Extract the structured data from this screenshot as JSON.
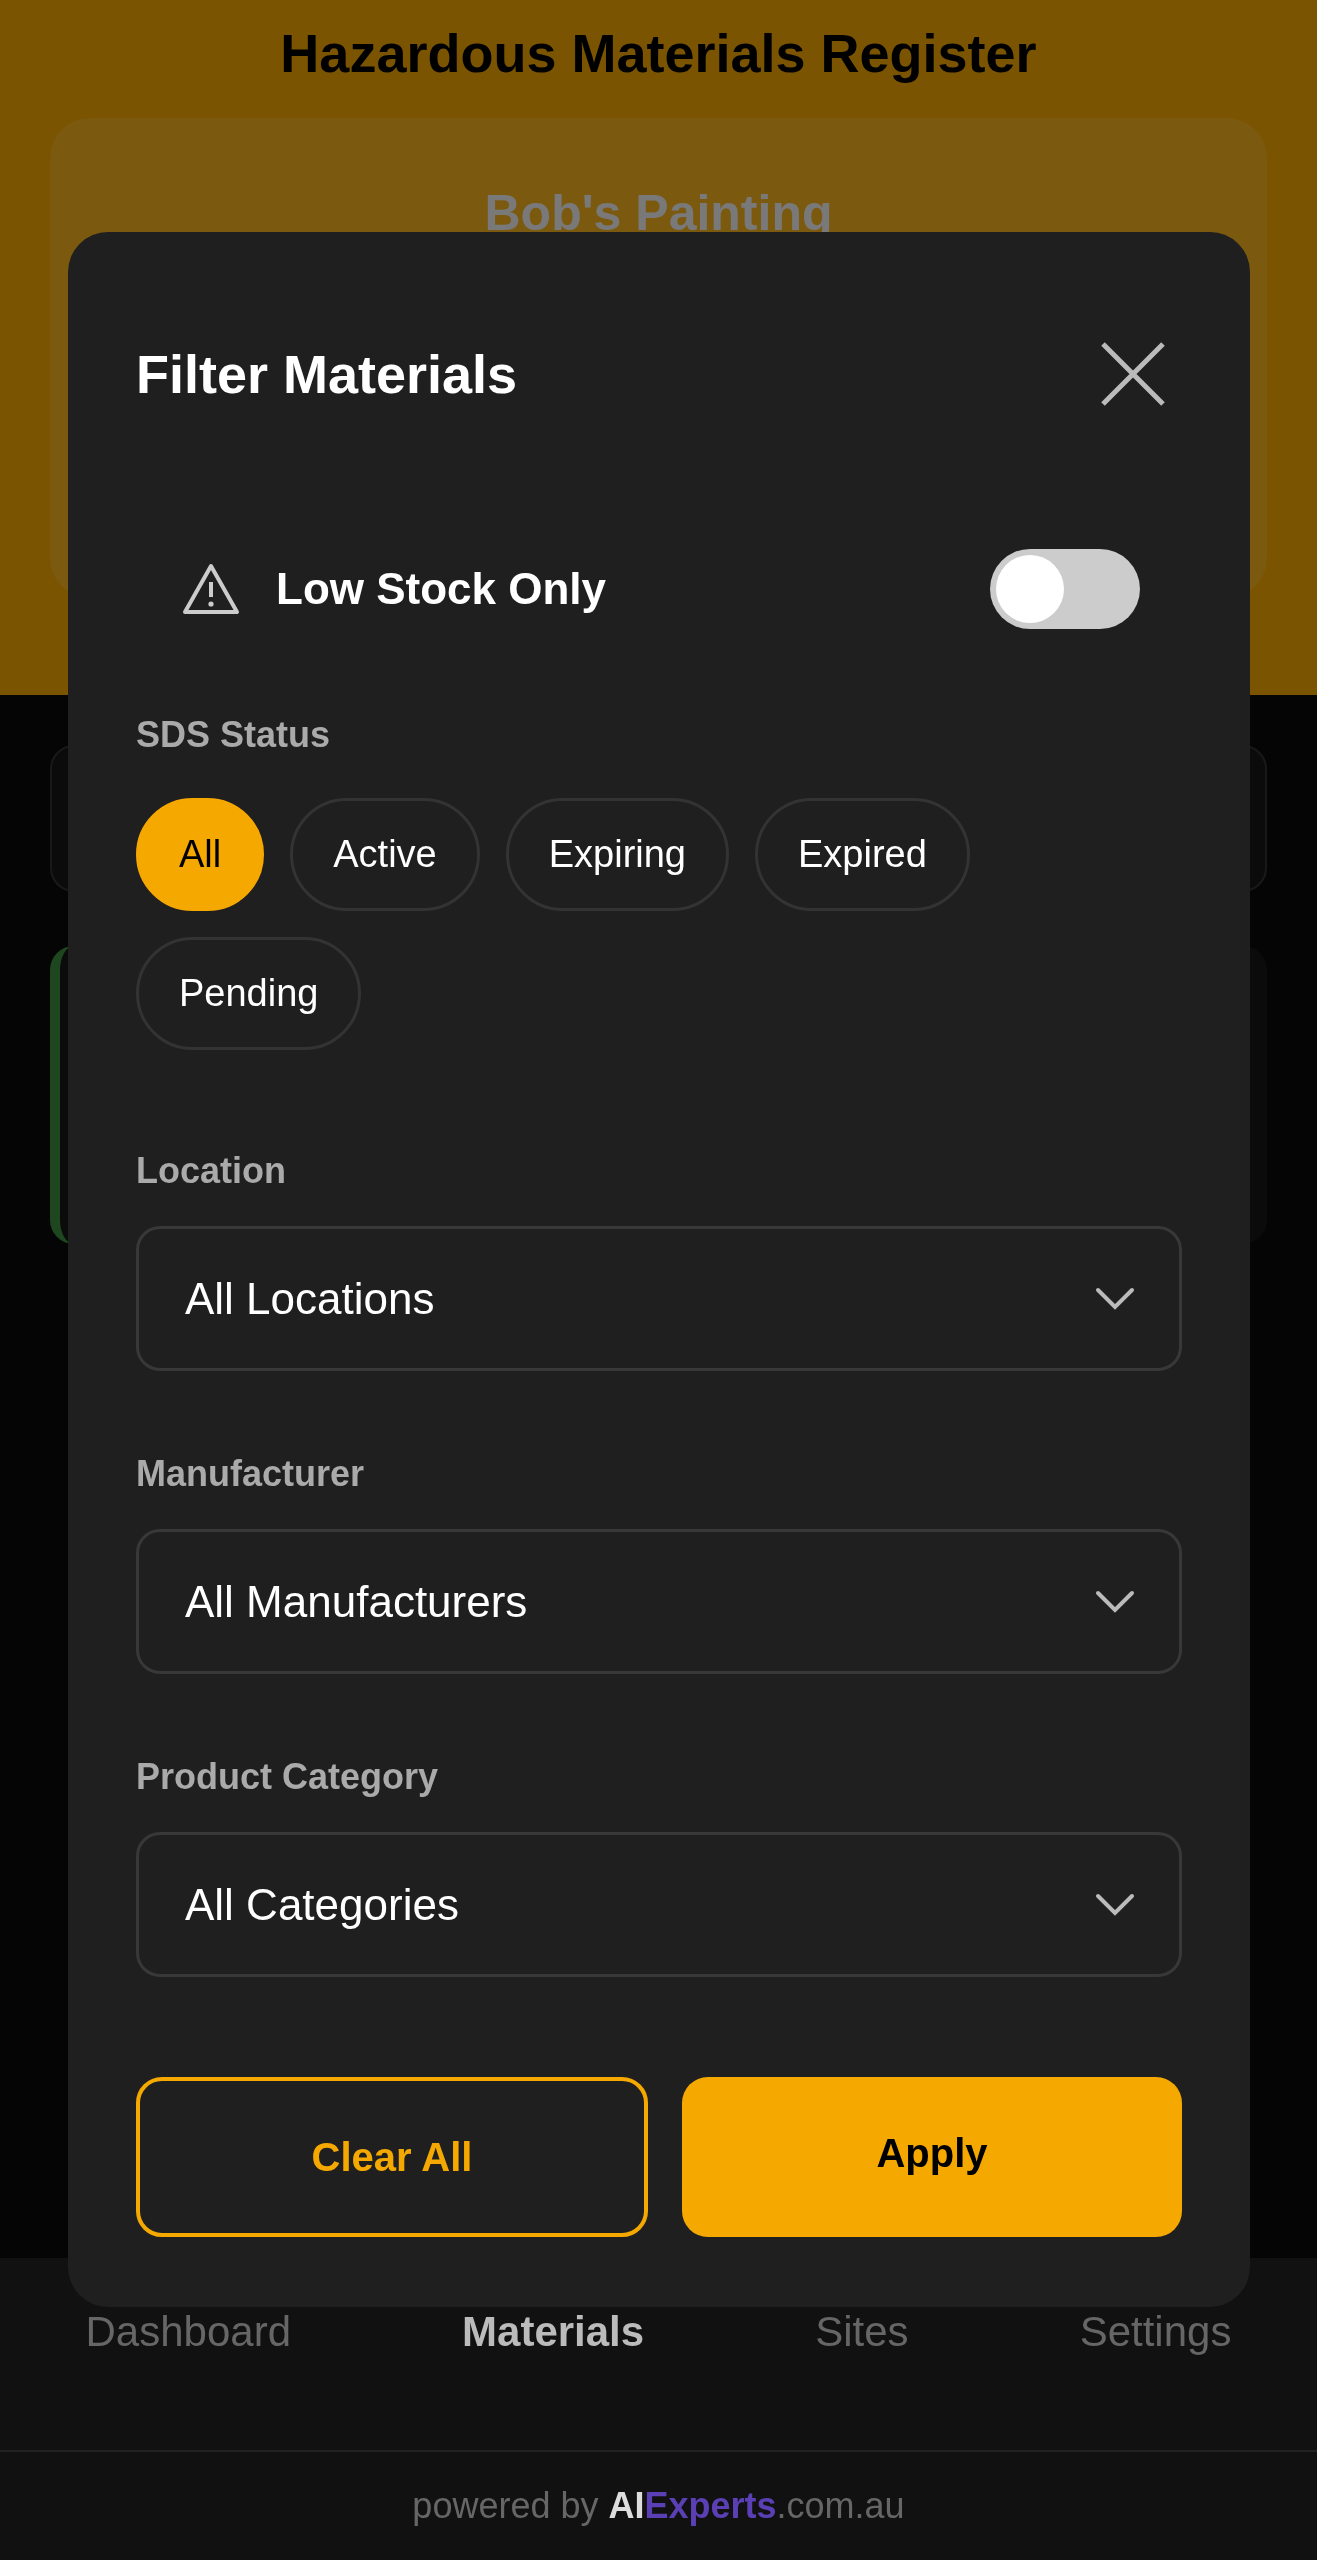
{
  "header": {
    "title": "Hazardous Materials Register",
    "business_name": "Bob's Painting"
  },
  "filter_dialog": {
    "title": "Filter Materials",
    "low_stock_toggle": {
      "label": "Low Stock Only",
      "on": false
    },
    "sds_status": {
      "label": "SDS Status",
      "options": [
        {
          "label": "All",
          "selected": true
        },
        {
          "label": "Active",
          "selected": false
        },
        {
          "label": "Expiring",
          "selected": false
        },
        {
          "label": "Expired",
          "selected": false
        },
        {
          "label": "Pending",
          "selected": false
        }
      ]
    },
    "dropdowns": [
      {
        "label": "Location",
        "value": "All Locations"
      },
      {
        "label": "Manufacturer",
        "value": "All Manufacturers"
      },
      {
        "label": "Product Category",
        "value": "All Categories"
      }
    ],
    "buttons": [
      {
        "label": "Clear All",
        "kind": "outline"
      },
      {
        "label": "Apply",
        "kind": "primary"
      }
    ]
  },
  "bottom_nav": [
    {
      "label": "Dashboard",
      "selected": false
    },
    {
      "label": "Materials",
      "selected": true
    },
    {
      "label": "Sites",
      "selected": false
    },
    {
      "label": "Settings",
      "selected": false
    }
  ],
  "footer": {
    "prefix": "powered by",
    "brand_first": "AI",
    "brand_second": "Experts",
    "suffix": ".com.au"
  }
}
